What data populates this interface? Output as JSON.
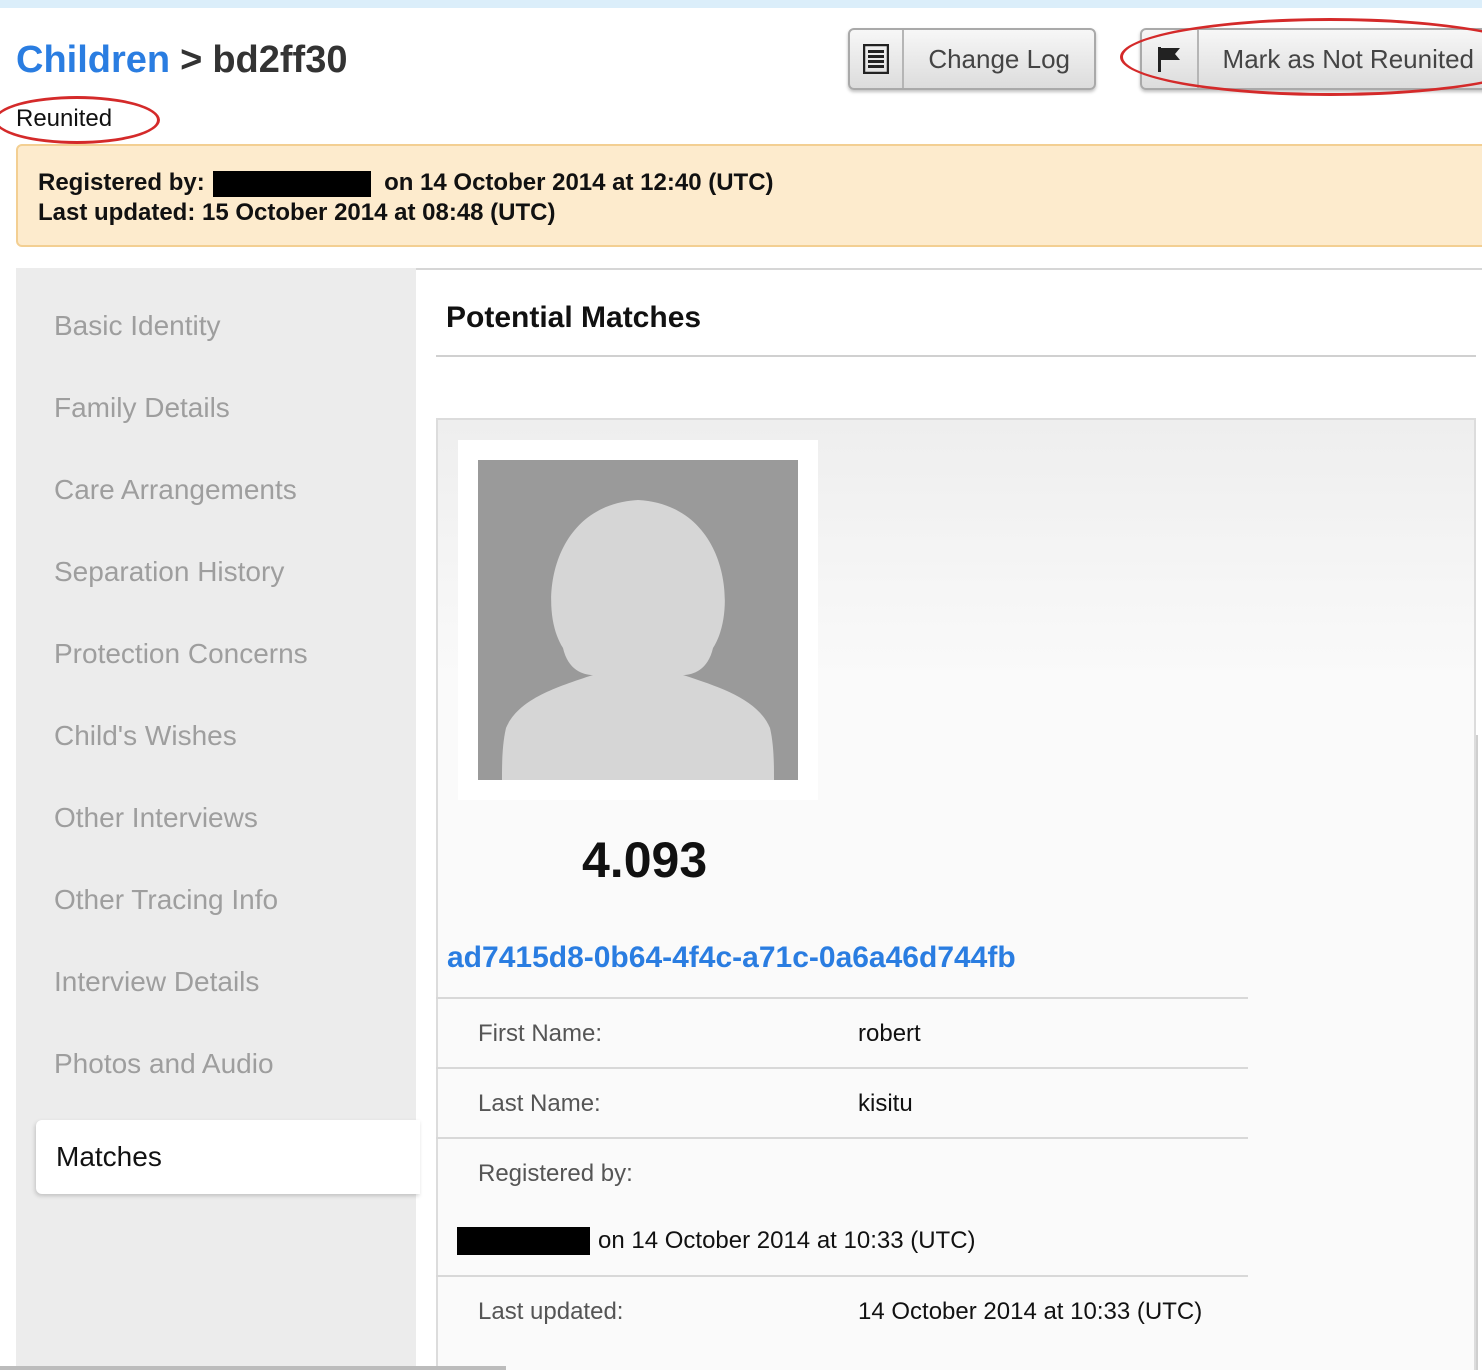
{
  "breadcrumb": {
    "parent": "Children",
    "separator": ">",
    "current": "bd2ff30"
  },
  "status": "Reunited",
  "toolbar": {
    "change_log_label": "Change Log",
    "change_log_icon": "document-list-icon",
    "mark_label": "Mark as Not Reunited",
    "mark_icon": "flag-icon"
  },
  "record_info": {
    "registered_by_label": "Registered by:",
    "registered_on": "on 14 October 2014 at 12:40 (UTC)",
    "last_updated_label": "Last updated:",
    "last_updated_value": "15 October 2014 at 08:48 (UTC)"
  },
  "sidebar": {
    "items": [
      {
        "label": "Basic Identity"
      },
      {
        "label": "Family Details"
      },
      {
        "label": "Care Arrangements"
      },
      {
        "label": "Separation History"
      },
      {
        "label": "Protection Concerns"
      },
      {
        "label": "Child's Wishes"
      },
      {
        "label": "Other Interviews"
      },
      {
        "label": "Other Tracing Info"
      },
      {
        "label": "Interview Details"
      },
      {
        "label": "Photos and Audio"
      },
      {
        "label": "Matches",
        "active": true
      }
    ]
  },
  "main": {
    "section_title": "Potential Matches",
    "match": {
      "score": "4.093",
      "id": "ad7415d8-0b64-4f4c-a71c-0a6a46d744fb",
      "first_name_label": "First Name:",
      "first_name": "robert",
      "last_name_label": "Last Name:",
      "last_name": "kisitu",
      "registered_by_label": "Registered by:",
      "registered_on": "on 14 October 2014 at 10:33 (UTC)",
      "last_updated_label": "Last updated:",
      "last_updated": "14 October 2014 at 10:33 (UTC)"
    }
  },
  "colors": {
    "link": "#2a7de1",
    "highlight_ellipse": "#d42a2a",
    "info_bar_bg": "#fdebcd",
    "sidebar_bg": "#ececec"
  }
}
